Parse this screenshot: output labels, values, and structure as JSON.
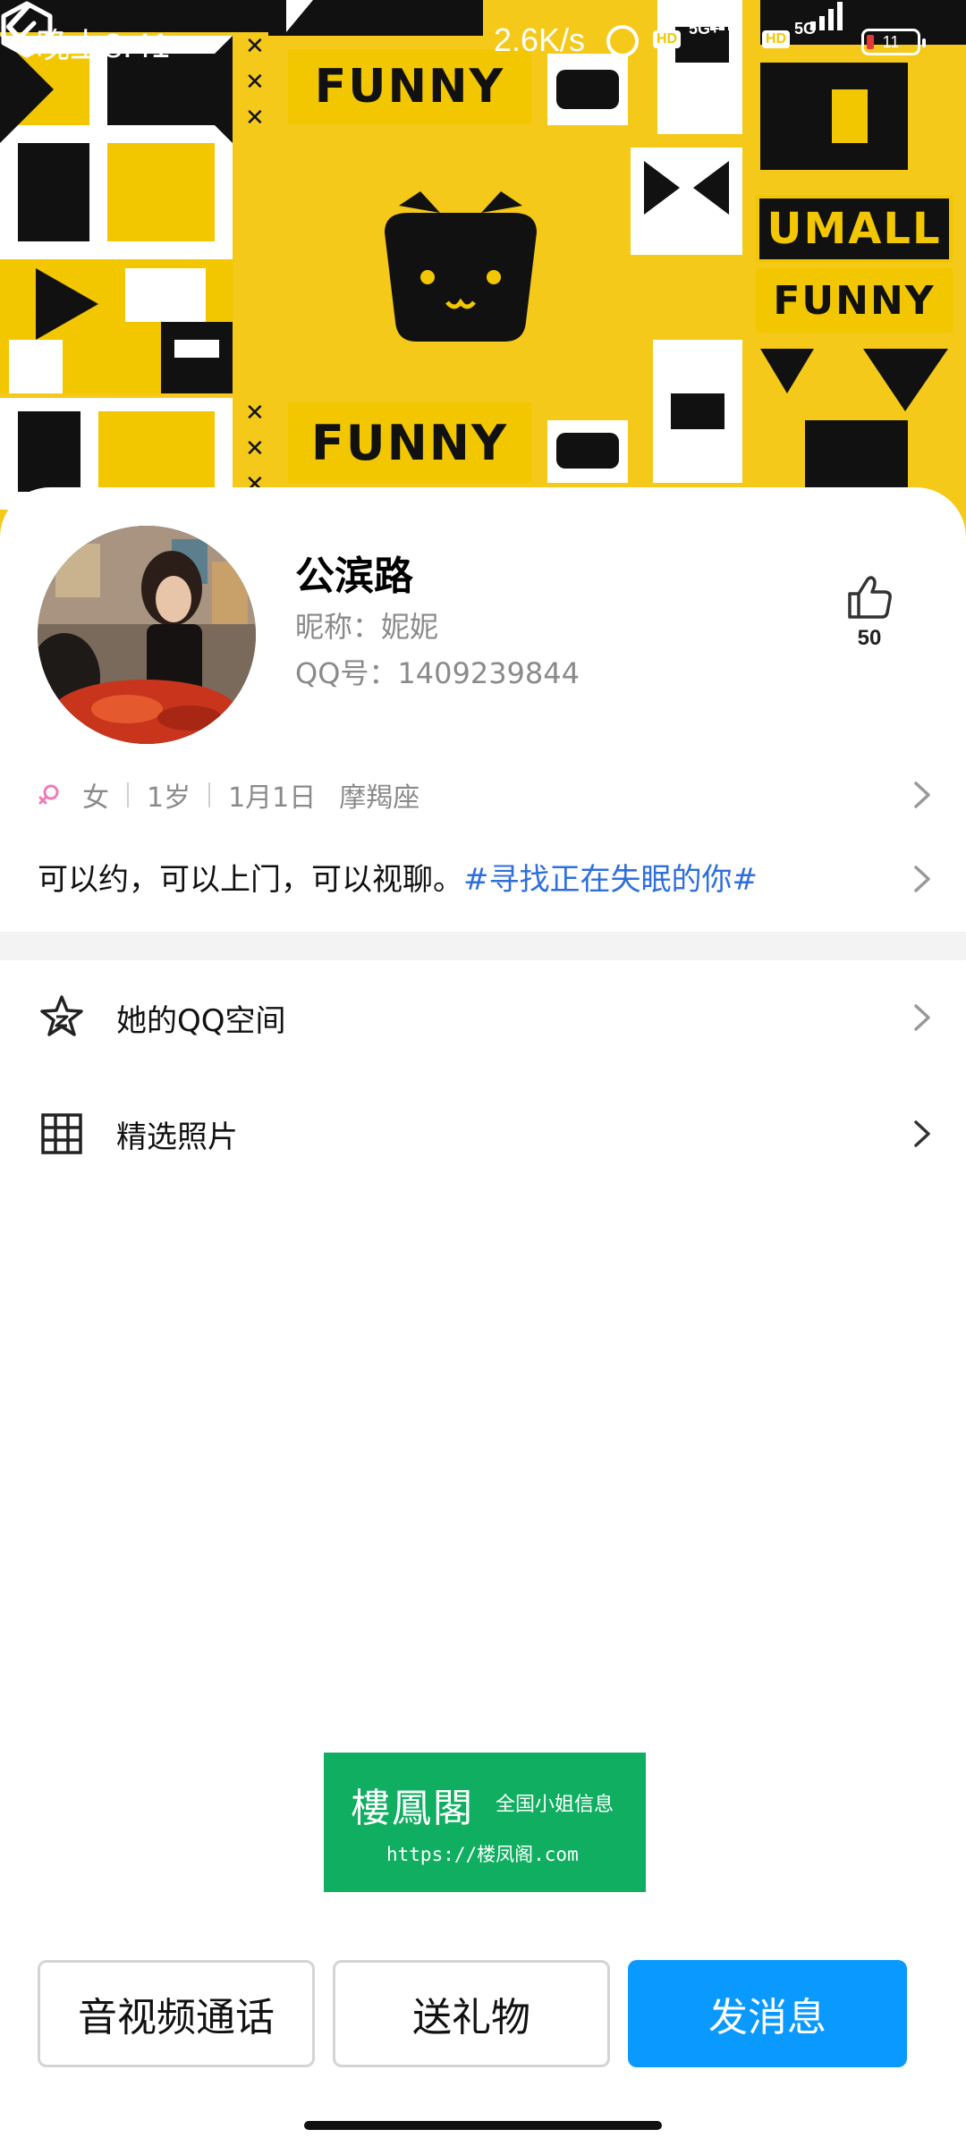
{
  "status_bar": {
    "time": "晚上8:41",
    "net_speed": "2.6K/s",
    "hd_badge": "HD",
    "net1": "5G+",
    "net2": "5G",
    "battery": "11"
  },
  "cover": {
    "words": [
      "FUNNY",
      "FUNNY",
      "UMALL",
      "FUNNY"
    ]
  },
  "profile": {
    "name": "公滨路",
    "nickname_label": "昵称：",
    "nickname": "妮妮",
    "qq_label": "QQ号：",
    "qq": "1409239844",
    "likes": "50"
  },
  "info": {
    "gender": "女",
    "age": "1岁",
    "birthday": "1月1日",
    "zodiac": "摩羯座"
  },
  "bio": {
    "text": "可以约，可以上门，可以视聊。",
    "tag": "#寻找正在失眠的你#"
  },
  "menu": {
    "qzone": "她的QQ空间",
    "photos": "精选照片"
  },
  "watermark": {
    "title": "樓鳳閣",
    "subtitle": "全国小姐信息",
    "url": "https://楼凤阁.com"
  },
  "actions": {
    "call": "音视频通话",
    "gift": "送礼物",
    "message": "发消息"
  },
  "colors": {
    "accent_blue": "#0a99ff",
    "tag_blue": "#2f6fdc",
    "cover_yellow": "#f4c91a",
    "watermark_green": "#0fae60"
  }
}
